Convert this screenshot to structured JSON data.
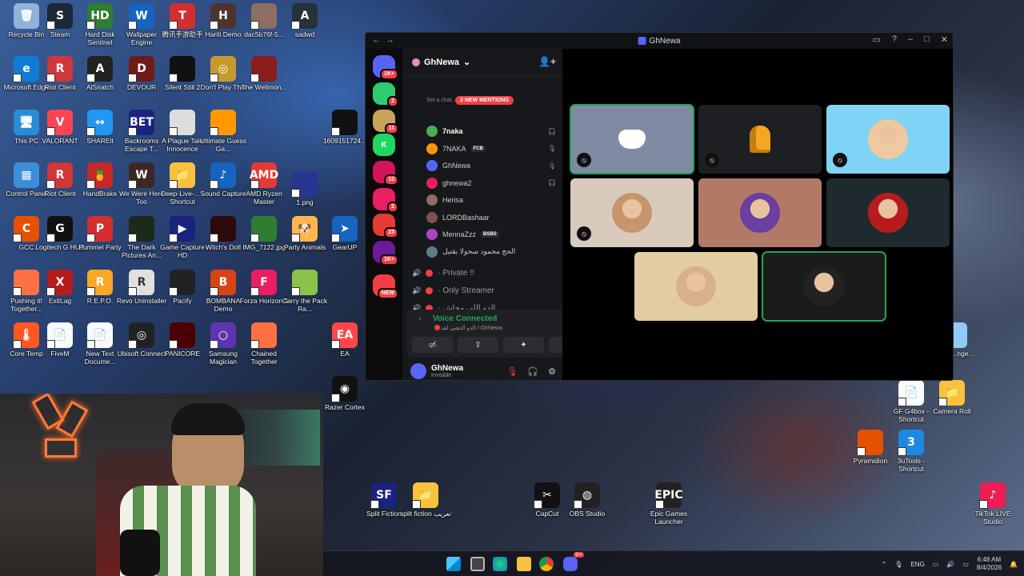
{
  "desktop_icons": [
    {
      "label": "Recycle Bin",
      "glyph": "🗑",
      "color": "#8fb3d9"
    },
    {
      "label": "Steam",
      "glyph": "S",
      "color": "#1b2838"
    },
    {
      "label": "Hard Disk Sentinel",
      "glyph": "HD",
      "color": "#2e7d32"
    },
    {
      "label": "Wallpaper Engine",
      "glyph": "W",
      "color": "#1565c0"
    },
    {
      "label": "腾讯手游助手",
      "glyph": "T",
      "color": "#d32f2f"
    },
    {
      "label": "Hariti Demo",
      "glyph": "H",
      "color": "#4e342e"
    },
    {
      "label": "dac5b76f-5...",
      "glyph": "",
      "color": "#8d6e63"
    },
    {
      "label": "sadwd",
      "glyph": "A",
      "color": "#263238"
    },
    {
      "label": "Microsoft Edge",
      "glyph": "e",
      "color": "#0f7bd4"
    },
    {
      "label": "Riot Client",
      "glyph": "R",
      "color": "#d13639"
    },
    {
      "label": "AlSnatch",
      "glyph": "A",
      "color": "#222"
    },
    {
      "label": "DEVOUR",
      "glyph": "D",
      "color": "#6d1b1b"
    },
    {
      "label": "Silent Still 2",
      "glyph": "",
      "color": "#111"
    },
    {
      "label": "Don't Play This",
      "glyph": "◎",
      "color": "#c79a2c"
    },
    {
      "label": "The Wellmon...",
      "glyph": "",
      "color": "#8b1d1d"
    },
    {
      "label": "This PC",
      "glyph": "🖥",
      "color": "#2a8bd6"
    },
    {
      "label": "VALORANT",
      "glyph": "V",
      "color": "#fa4454"
    },
    {
      "label": "SHAREit",
      "glyph": "↔",
      "color": "#2196f3"
    },
    {
      "label": "Backrooms Escape T...",
      "glyph": "BET",
      "color": "#1a237e"
    },
    {
      "label": "A Plague Tale Innocence",
      "glyph": "",
      "color": "#ddd"
    },
    {
      "label": "Ultimate Guess Ga...",
      "glyph": "",
      "color": "#ff9800"
    },
    {
      "label": "Control Panel",
      "glyph": "▦",
      "color": "#3b8fd9"
    },
    {
      "label": "Riot Client",
      "glyph": "R",
      "color": "#d13639"
    },
    {
      "label": "HandBrake",
      "glyph": "🍍",
      "color": "#c62828"
    },
    {
      "label": "We Were Here Too",
      "glyph": "W",
      "color": "#3e2723"
    },
    {
      "label": "Deep-Live-... - Shortcut",
      "glyph": "📁",
      "color": "#f9c23c"
    },
    {
      "label": "Sound Capture",
      "glyph": "♪",
      "color": "#1565c0"
    },
    {
      "label": "AMD Ryzen Master",
      "glyph": "AMD",
      "color": "#e53935"
    },
    {
      "label": "1.png",
      "glyph": "",
      "color": "#283593"
    },
    {
      "label": "GCC",
      "glyph": "C",
      "color": "#e65100"
    },
    {
      "label": "Logitech G HUB",
      "glyph": "G",
      "color": "#111"
    },
    {
      "label": "Pummel Party",
      "glyph": "P",
      "color": "#d32f2f"
    },
    {
      "label": "The Dark Pictures An...",
      "glyph": "",
      "color": "#1b2a1b"
    },
    {
      "label": "Game Capture HD",
      "glyph": "▶",
      "color": "#1a237e"
    },
    {
      "label": "Witch's Doll",
      "glyph": "",
      "color": "#2e0a0a"
    },
    {
      "label": "IMG_7122.jpg",
      "glyph": "",
      "color": "#2e7d32"
    },
    {
      "label": "Party Animals",
      "glyph": "🐶",
      "color": "#ffb74d"
    },
    {
      "label": "GearUP",
      "glyph": "➤",
      "color": "#1565c0"
    },
    {
      "label": "Pushing it! Together...",
      "glyph": "",
      "color": "#ff7043"
    },
    {
      "label": "ExitLag",
      "glyph": "X",
      "color": "#b71c1c"
    },
    {
      "label": "R.E.P.O.",
      "glyph": "R",
      "color": "#f9a825"
    },
    {
      "label": "Revo Uninstaller",
      "glyph": "R",
      "color": "#e0e0e0"
    },
    {
      "label": "Pacify",
      "glyph": "",
      "color": "#222"
    },
    {
      "label": "BOMBANA Demo",
      "glyph": "B",
      "color": "#d84315"
    },
    {
      "label": "Forza Horizon 5",
      "glyph": "F",
      "color": "#e91e63"
    },
    {
      "label": "Carry the Pack Ra...",
      "glyph": "",
      "color": "#8bc34a"
    },
    {
      "label": "Core Temp",
      "glyph": "🌡",
      "color": "#ff5722"
    },
    {
      "label": "FiveM",
      "glyph": "📄",
      "color": "#fafafa"
    },
    {
      "label": "New Text Docume...",
      "glyph": "📄",
      "color": "#fafafa"
    },
    {
      "label": "Ubisoft Connect",
      "glyph": "◎",
      "color": "#222"
    },
    {
      "label": "PANICORE",
      "glyph": "",
      "color": "#4a0000"
    },
    {
      "label": "Samsung Magician",
      "glyph": "○",
      "color": "#5e35b1"
    },
    {
      "label": "Chained Together",
      "glyph": "",
      "color": "#ff7043"
    },
    {
      "label": "1609151724...",
      "glyph": "",
      "color": "#111"
    },
    {
      "label": "EA",
      "glyph": "EA",
      "color": "#ff4747"
    },
    {
      "label": "Razer Cortex",
      "glyph": "◉",
      "color": "#111"
    },
    {
      "label": "GF G4box - Shortcut",
      "glyph": "📄",
      "color": "#fafafa"
    },
    {
      "label": "Camera Roll",
      "glyph": "📁",
      "color": "#f9c23c"
    },
    {
      "label": "Pyramidion",
      "glyph": "",
      "color": "#e65100"
    },
    {
      "label": "3uTools - Shortcut",
      "glyph": "3",
      "color": "#1e88e5"
    },
    {
      "label": "Split Fiction",
      "glyph": "SF",
      "color": "#1a237e"
    },
    {
      "label": "split fiction تعريب",
      "glyph": "📁",
      "color": "#f9c23c"
    },
    {
      "label": "CapCut",
      "glyph": "✂",
      "color": "#111"
    },
    {
      "label": "OBS Studio",
      "glyph": "◍",
      "color": "#222"
    },
    {
      "label": "Epic Games Launcher",
      "glyph": "EPIC",
      "color": "#222"
    },
    {
      "label": "TikTok LIVE Studio",
      "glyph": "♪",
      "color": "#ee1d52"
    },
    {
      "label": "...eel ...nge...",
      "glyph": "",
      "color": "#90caf9"
    }
  ],
  "discord": {
    "window_title": "GhNewa",
    "guild_name": "GhNewa",
    "mention_pill": "2 NEW MENTIONS",
    "set_chat": "Set a chat...",
    "server_badges": [
      "1K+",
      "2",
      "11",
      "",
      "10",
      "2",
      "23",
      "1K+",
      "NEW"
    ],
    "members": [
      {
        "name": "7naka",
        "tag": "",
        "color": "#4caf50",
        "status": "🎧"
      },
      {
        "name": "7NAKA",
        "tag": "FCB",
        "color": "#ff9800",
        "status": "🎙"
      },
      {
        "name": "GhNewa",
        "tag": "",
        "color": "#5865f2",
        "status": "🎙"
      },
      {
        "name": "ghnewa2",
        "tag": "",
        "color": "#e91e63",
        "status": "🎧"
      },
      {
        "name": "Herisa",
        "tag": "",
        "color": "#8d6e63",
        "status": ""
      },
      {
        "name": "LORDBashaar",
        "tag": "",
        "color": "#795548",
        "status": ""
      },
      {
        "name": "MennaZzz",
        "tag": "BSBS",
        "color": "#ab47bc",
        "status": ""
      },
      {
        "name": "الحج محمود سحولا بقتيل",
        "tag": "",
        "color": "#607d8b",
        "status": ""
      }
    ],
    "voice_channels": [
      "Private !!",
      "Only Streamer",
      "الدو اللي مجاش"
    ],
    "voice_status": "Voice Connected",
    "voice_sub": "الدو الذهبي لقد / GhNewa",
    "user_name": "GhNewa",
    "user_status": "Invisible",
    "tiles": [
      {
        "kind": "discord-logo",
        "bg": "#7f8aa3",
        "speaking": true,
        "muted": true
      },
      {
        "kind": "among-us",
        "bg": "#1e1f22",
        "speaking": false,
        "muted": true
      },
      {
        "kind": "avatar",
        "bg": "#7fd3f5",
        "speaking": false,
        "muted": true
      },
      {
        "kind": "avatar",
        "bg": "#d8cbbd",
        "speaking": false,
        "muted": true
      },
      {
        "kind": "avatar",
        "bg": "#b07a66",
        "speaking": false,
        "muted": false
      },
      {
        "kind": "avatar",
        "bg": "#1f2a2e",
        "speaking": false,
        "muted": false
      },
      {
        "kind": "avatar",
        "bg": "#e3cda0",
        "speaking": false,
        "muted": false
      },
      {
        "kind": "avatar",
        "bg": "#1a1c1a",
        "speaking": true,
        "muted": false
      }
    ]
  },
  "taskbar": {
    "language": "ENG",
    "time": "6:48 AM",
    "date": "8/4/2026",
    "discord_badge": "9+"
  }
}
